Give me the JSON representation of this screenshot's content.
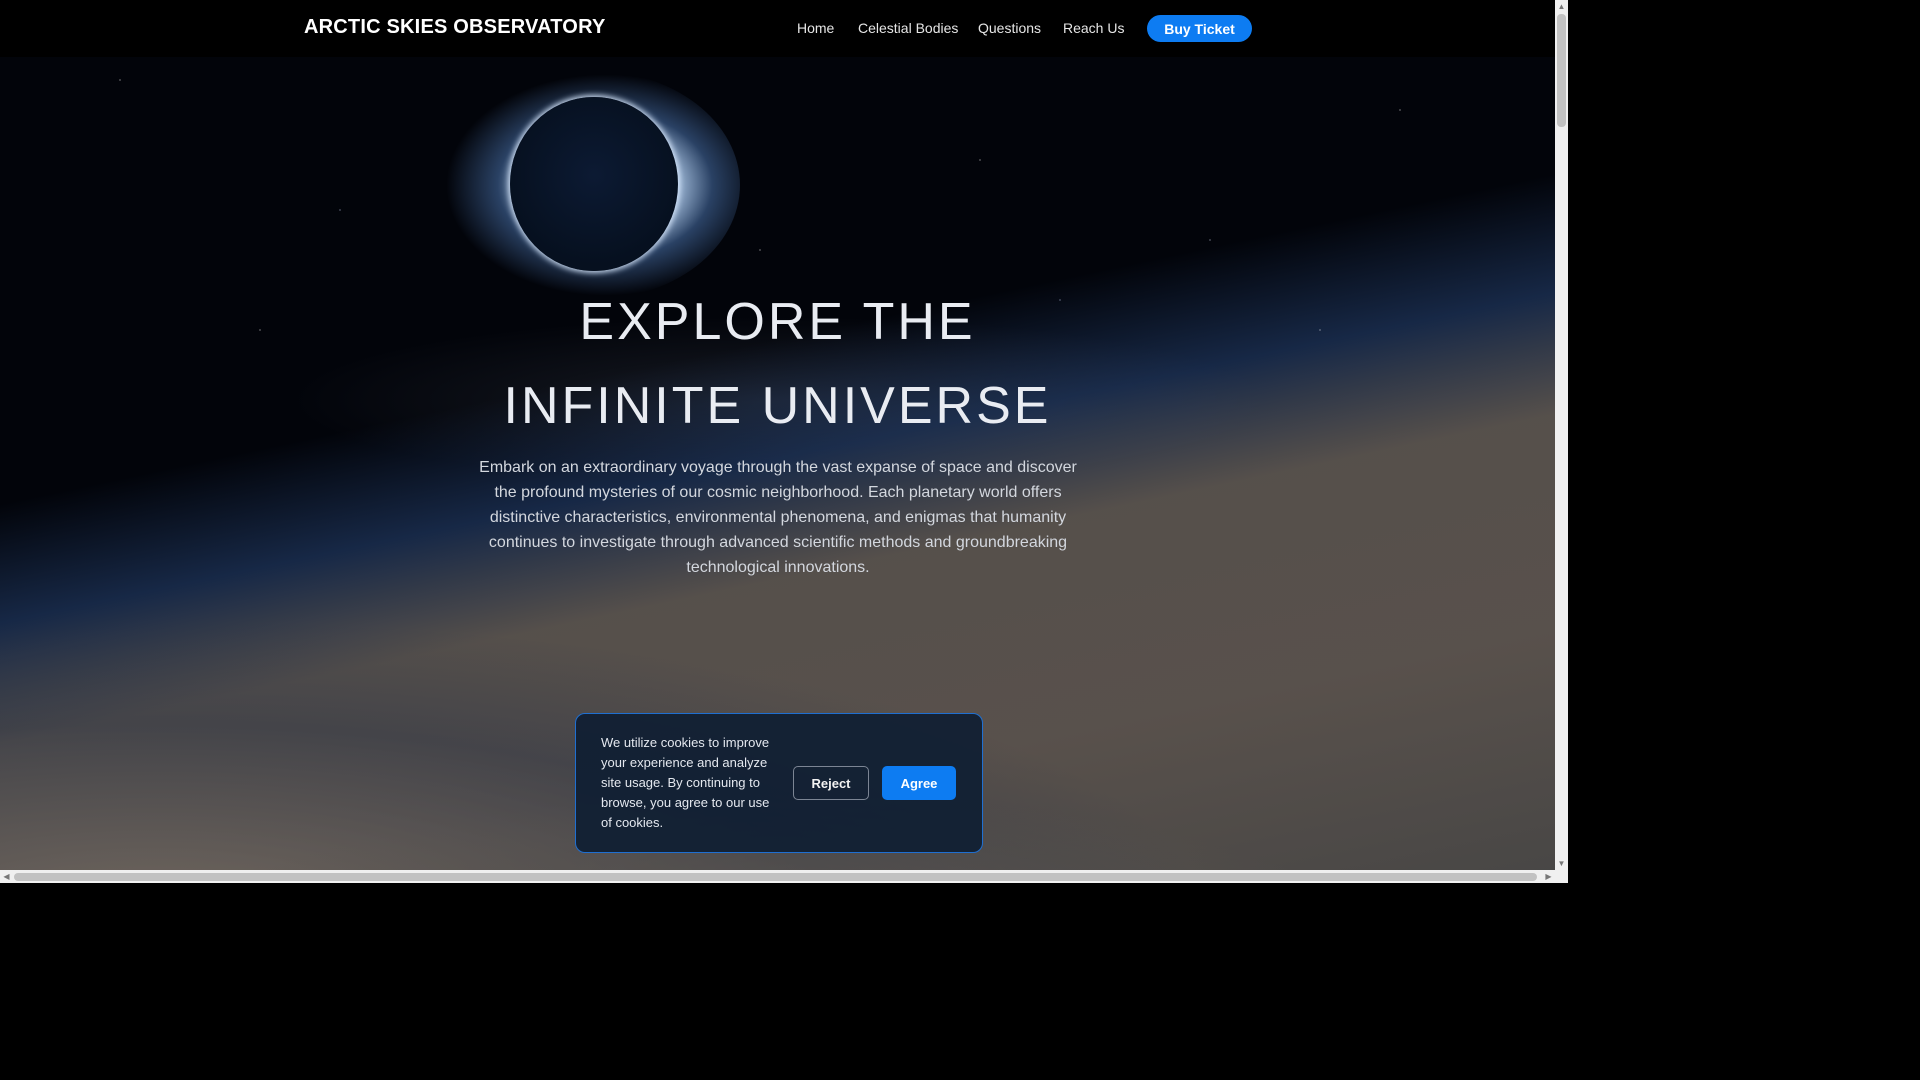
{
  "header": {
    "brand": "ARCTIC SKIES OBSERVATORY",
    "nav": {
      "home": "Home",
      "celestial_bodies": "Celestial Bodies",
      "questions": "Questions",
      "reach_us": "Reach Us"
    },
    "buy_ticket": "Buy Ticket"
  },
  "hero": {
    "title_line1": "EXPLORE THE",
    "title_line2": "INFINITE UNIVERSE",
    "description": "Embark on an extraordinary voyage through the vast expanse of space and discover the profound mysteries of our cosmic neighborhood. Each planetary world offers distinctive characteristics, environmental phenomena, and enigmas that humanity continues to investigate through advanced scientific methods and groundbreaking technological innovations."
  },
  "cookie_banner": {
    "message": "We utilize cookies to improve your experience and analyze site usage. By continuing to browse, you agree to our use of cookies.",
    "reject_label": "Reject",
    "agree_label": "Agree"
  },
  "scrollbars": {
    "up_arrow": "▲",
    "down_arrow": "▼",
    "left_arrow": "◀",
    "right_arrow": "▶"
  },
  "colors": {
    "accent": "#0d7cf2",
    "navbar_bg": "#000000",
    "cookie_border": "#1f6fd1"
  }
}
